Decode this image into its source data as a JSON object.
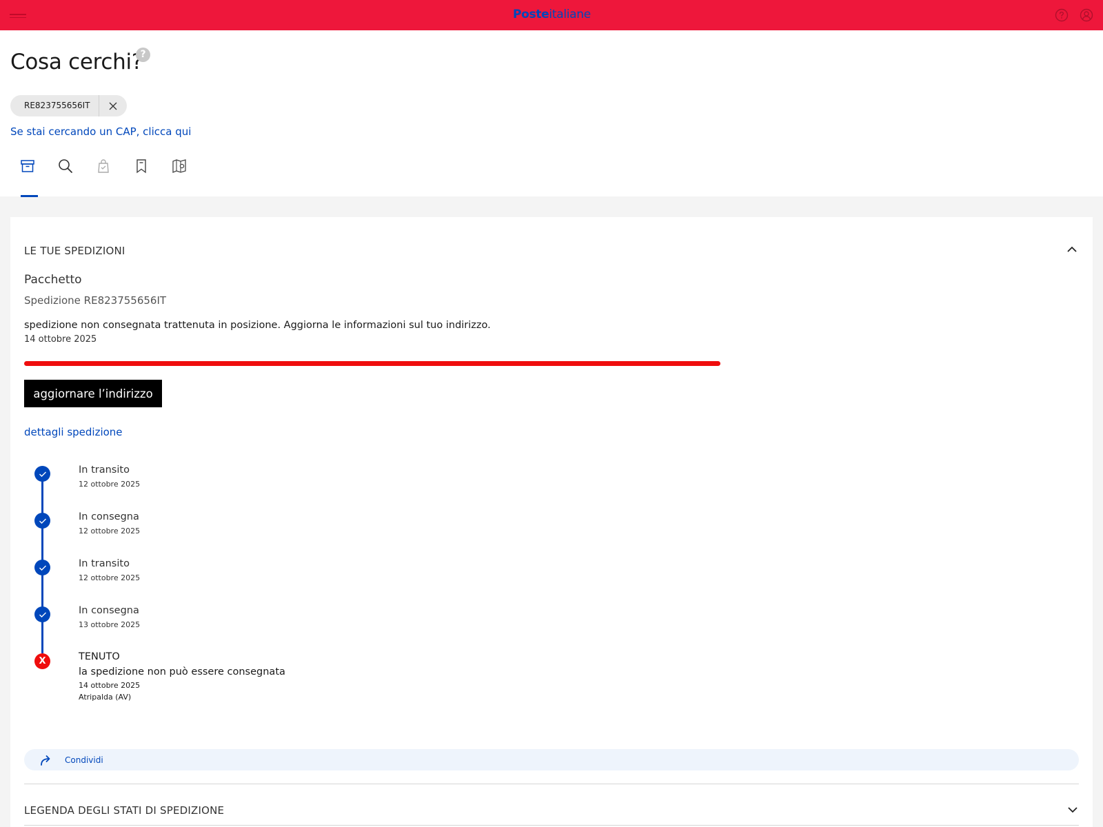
{
  "header": {
    "brand_bold": "Poste",
    "brand_light": "italiane",
    "colors": {
      "bar": "#ee173b",
      "brand": "#0047bb"
    },
    "icons": [
      "menu-icon",
      "help-circle-icon",
      "user-icon"
    ]
  },
  "search": {
    "title": "Cosa cerchi?",
    "help_badge": "?",
    "chip_value": "RE823755656IT",
    "cap_link": "Se stai cercando un CAP, clicca qui",
    "tabs": [
      "package-box-icon",
      "search-icon",
      "bag-icon",
      "bookmark-icon",
      "map-pin-icon"
    ],
    "active_tab": 0
  },
  "shipment": {
    "section_title": "LE TUE SPEDIZIONI",
    "type": "Pacchetto",
    "code": "Spedizione RE823755656IT",
    "status_message": "spedizione non consegnata trattenuta in posizione. Aggiorna le informazioni sul tuo indirizzo.",
    "status_date": "14 ottobre 2025",
    "progress_fraction": 1.0,
    "progress_color": "#ef0d0d",
    "update_button": "aggiornare l’indirizzo",
    "details_link": "dettagli spedizione"
  },
  "timeline": {
    "steps": [
      {
        "title": "In transito",
        "date": "12 ottobre 2025"
      },
      {
        "title": "In consegna",
        "date": "12 ottobre 2025"
      },
      {
        "title": "In transito",
        "date": "12 ottobre 2025"
      },
      {
        "title": "In consegna",
        "date": "13 ottobre 2025"
      }
    ],
    "last": {
      "mark": "X",
      "title": "TENUTO",
      "subtitle": "la spedizione non può essere consegnata",
      "date": "14 ottobre 2025",
      "location": "Atripalda (AV)"
    }
  },
  "share": {
    "label": "Condividi"
  },
  "legend": {
    "title": "LEGENDA DEGLI STATI DI SPEDIZIONE"
  }
}
